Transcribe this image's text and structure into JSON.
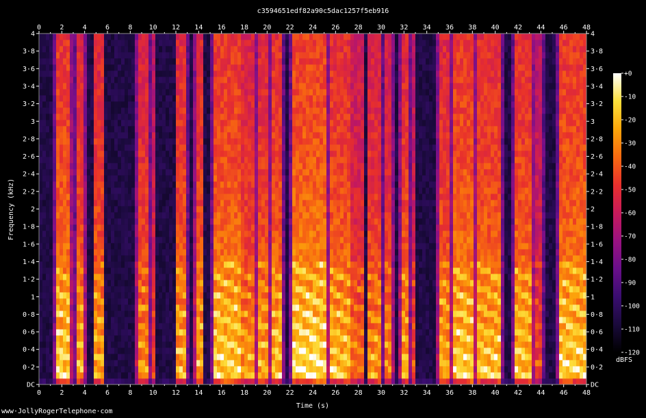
{
  "chart_data": {
    "type": "heatmap",
    "title": "c3594651edf82a90c5dac1257f5eb916",
    "xlabel": "Time (s)",
    "ylabel": "Frequency (kHz)",
    "xlim": [
      0,
      48
    ],
    "ylim": [
      0,
      4
    ],
    "x_ticks": [
      "0",
      "2",
      "4",
      "6",
      "8",
      "10",
      "12",
      "14",
      "16",
      "18",
      "20",
      "22",
      "24",
      "26",
      "28",
      "30",
      "32",
      "34",
      "36",
      "38",
      "40",
      "42",
      "44",
      "46",
      "48"
    ],
    "y_ticks": [
      "DC",
      "0·2",
      "0·4",
      "0·6",
      "0·8",
      "1",
      "1·2",
      "1·4",
      "1·6",
      "1·8",
      "2",
      "2·2",
      "2·4",
      "2·6",
      "2·8",
      "3",
      "3·2",
      "3·4",
      "3·6",
      "3·8",
      "4"
    ],
    "colorbar": {
      "label": "dBFS",
      "ticks": [
        "+0",
        "-10",
        "-20",
        "-30",
        "-40",
        "-50",
        "-60",
        "-70",
        "-80",
        "-90",
        "-100",
        "-110",
        "-120"
      ],
      "range": [
        -120,
        0
      ],
      "colors": [
        "#000000",
        "#1a0a3c",
        "#3a0d70",
        "#6a0f8a",
        "#9a1280",
        "#c81a5a",
        "#e8302c",
        "#f86a10",
        "#fca60a",
        "#fde03c",
        "#ffffff"
      ]
    },
    "activity_segments": [
      [
        1.5,
        2.8,
        0.95
      ],
      [
        3.3,
        4.0,
        0.85
      ],
      [
        4.9,
        5.6,
        0.85
      ],
      [
        8.6,
        9.6,
        0.8
      ],
      [
        9.8,
        10.1,
        0.6
      ],
      [
        12.1,
        12.9,
        0.85
      ],
      [
        13.7,
        14.3,
        0.85
      ],
      [
        15.3,
        17.6,
        0.95
      ],
      [
        17.6,
        18.8,
        0.8
      ],
      [
        19.1,
        20.2,
        0.85
      ],
      [
        20.3,
        21.3,
        0.9
      ],
      [
        22.2,
        25.2,
        1.0
      ],
      [
        25.4,
        27.2,
        0.9
      ],
      [
        27.3,
        28.4,
        0.7
      ],
      [
        28.9,
        29.9,
        0.8
      ],
      [
        30.3,
        31.0,
        0.75
      ],
      [
        31.7,
        32.3,
        0.85
      ],
      [
        32.6,
        32.9,
        0.6
      ],
      [
        35.0,
        36.1,
        0.85
      ],
      [
        36.3,
        38.2,
        0.95
      ],
      [
        38.4,
        40.5,
        0.9
      ],
      [
        41.7,
        43.3,
        0.9
      ],
      [
        43.5,
        44.1,
        0.6
      ],
      [
        45.6,
        48.0,
        0.95
      ]
    ]
  },
  "footer": "www·JollyRogerTelephone·com"
}
